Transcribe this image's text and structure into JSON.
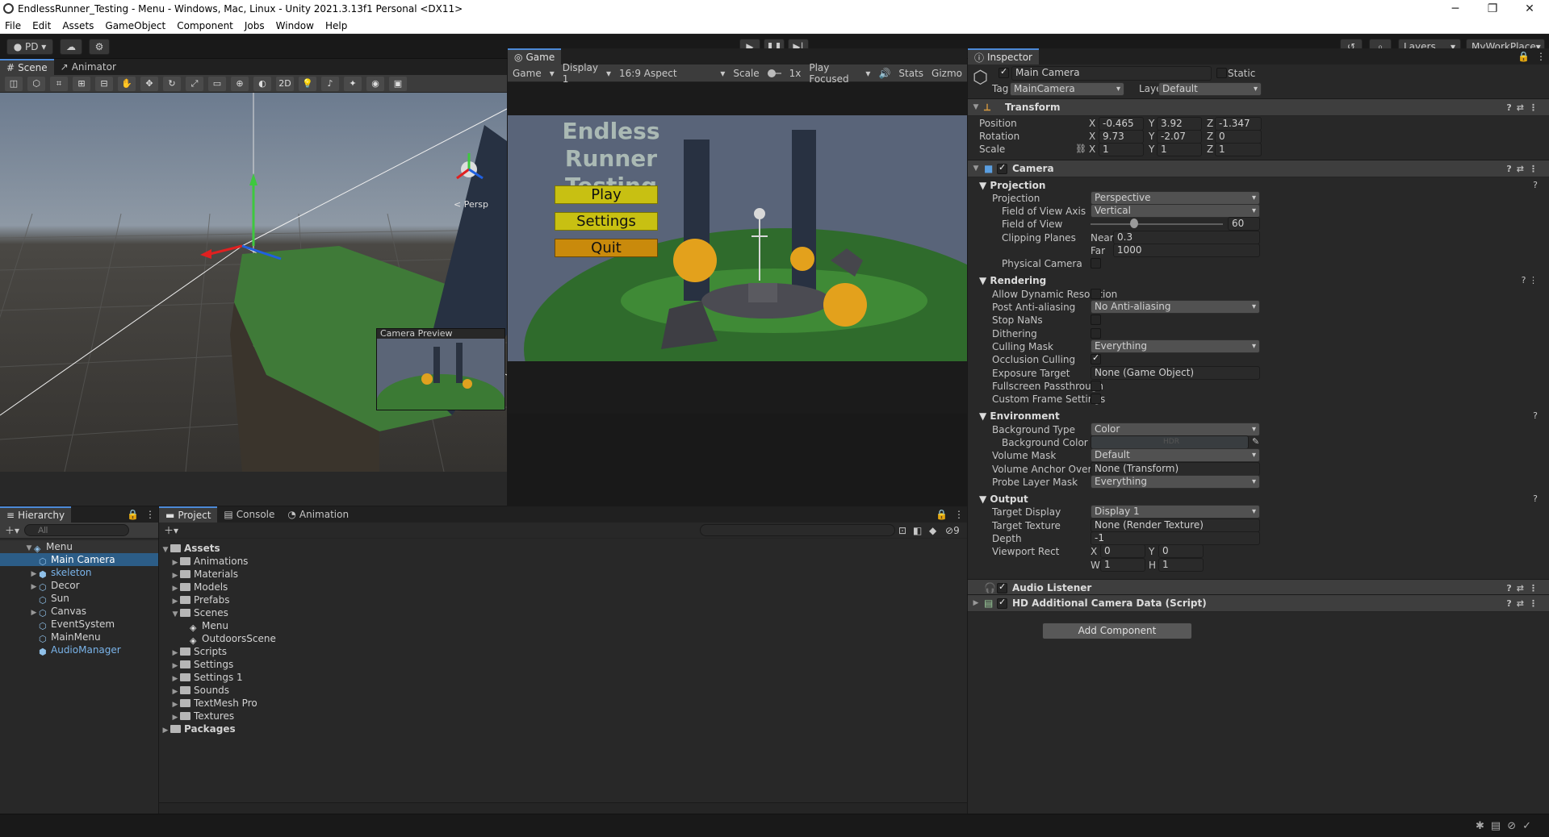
{
  "window": {
    "title": "EndlessRunner_Testing - Menu - Windows, Mac, Linux - Unity 2021.3.13f1 Personal <DX11>"
  },
  "menu": [
    "File",
    "Edit",
    "Assets",
    "GameObject",
    "Component",
    "Jobs",
    "Window",
    "Help"
  ],
  "toolbar": {
    "account": "PD",
    "layers": "Layers",
    "layout": "MyWorkPlace"
  },
  "scene": {
    "tab_scene": "Scene",
    "tab_animator": "Animator",
    "persp": "< Persp",
    "btn_2d": "2D",
    "camera_preview": "Camera Preview"
  },
  "game": {
    "tab": "Game",
    "mode": "Game",
    "display": "Display 1",
    "aspect": "16:9 Aspect",
    "scale_label": "Scale",
    "scale_value": "1x",
    "play_focused": "Play Focused",
    "stats": "Stats",
    "gizmos": "Gizmo",
    "title_line1": "Endless Runner",
    "title_line2": "Testing",
    "play": "Play",
    "settings": "Settings",
    "quit": "Quit"
  },
  "hierarchy": {
    "tab": "Hierarchy",
    "search_placeholder": "All",
    "scene": "Menu",
    "items": [
      "Main Camera",
      "skeleton",
      "Decor",
      "Sun",
      "Canvas",
      "EventSystem",
      "MainMenu",
      "AudioManager"
    ]
  },
  "project": {
    "tab_project": "Project",
    "tab_console": "Console",
    "tab_animation": "Animation",
    "hidden_count": "9",
    "assets": "Assets",
    "folders": [
      "Animations",
      "Materials",
      "Models",
      "Prefabs",
      "Scenes",
      "Scripts",
      "Settings",
      "Settings 1",
      "Sounds",
      "TextMesh Pro",
      "Textures"
    ],
    "scenes": [
      "Menu",
      "OutdoorsScene"
    ],
    "packages": "Packages"
  },
  "inspector": {
    "tab": "Inspector",
    "object_name": "Main Camera",
    "static": "Static",
    "tag_label": "Tag",
    "tag": "MainCamera",
    "layer_label": "Layer",
    "layer": "Default",
    "transform": {
      "title": "Transform",
      "position": "Position",
      "rotation": "Rotation",
      "scale": "Scale",
      "px": "-0.465",
      "py": "3.92",
      "pz": "-1.347",
      "rx": "9.73",
      "ry": "-2.07",
      "rz": "0",
      "sx": "1",
      "sy": "1",
      "sz": "1",
      "X": "X",
      "Y": "Y",
      "Z": "Z"
    },
    "camera": {
      "title": "Camera",
      "projection_h": "Projection",
      "projection": "Projection",
      "projection_v": "Perspective",
      "fov_axis": "Field of View Axis",
      "fov_axis_v": "Vertical",
      "fov": "Field of View",
      "fov_v": "60",
      "fov_fraction": 0.33,
      "clipping": "Clipping Planes",
      "near": "Near",
      "near_v": "0.3",
      "far": "Far",
      "far_v": "1000",
      "physical": "Physical Camera",
      "rendering_h": "Rendering",
      "dyn_res": "Allow Dynamic Resolution",
      "post_aa": "Post Anti-aliasing",
      "post_aa_v": "No Anti-aliasing",
      "stop_nans": "Stop NaNs",
      "dithering": "Dithering",
      "culling_mask": "Culling Mask",
      "culling_mask_v": "Everything",
      "occlusion": "Occlusion Culling",
      "exposure": "Exposure Target",
      "exposure_v": "None (Game Object)",
      "fs_pass": "Fullscreen Passthrough",
      "custom_frame": "Custom Frame Settings",
      "environment_h": "Environment",
      "bg_type": "Background Type",
      "bg_type_v": "Color",
      "bg_color": "Background Color",
      "bg_hdr": "HDR",
      "volume_mask": "Volume Mask",
      "volume_mask_v": "Default",
      "volume_anchor": "Volume Anchor Override",
      "volume_anchor_v": "None (Transform)",
      "probe_mask": "Probe Layer Mask",
      "probe_mask_v": "Everything",
      "output_h": "Output",
      "target_display": "Target Display",
      "target_display_v": "Display 1",
      "target_texture": "Target Texture",
      "target_texture_v": "None (Render Texture)",
      "depth": "Depth",
      "depth_v": "-1",
      "viewport": "Viewport Rect",
      "vx": "0",
      "vy": "0",
      "vw": "1",
      "vh": "1",
      "W": "W",
      "H": "H"
    },
    "audio_listener": "Audio Listener",
    "hd_data": "HD Additional Camera Data (Script)",
    "add_component": "Add Component"
  },
  "colors": {
    "accent": "#2c5d87",
    "play_btn": "#c8c012",
    "quit_btn": "#c98a0c",
    "game_title": "#aab9b4"
  }
}
